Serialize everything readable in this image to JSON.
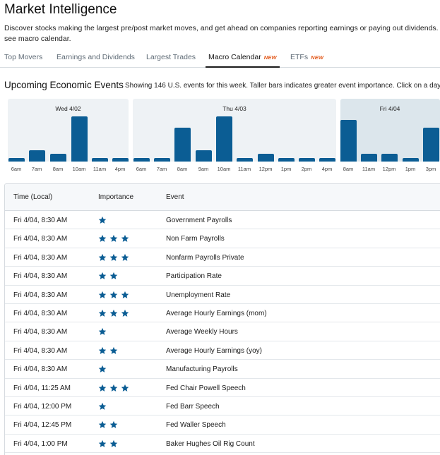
{
  "header": {
    "title": "Market Intelligence",
    "description": "Discover stocks making the largest pre/post market moves, and get ahead on companies reporting earnings or paying out dividends. Also see macro calendar."
  },
  "tabs": [
    {
      "label": "Top Movers",
      "badge": ""
    },
    {
      "label": "Earnings and Dividends",
      "badge": ""
    },
    {
      "label": "Largest Trades",
      "badge": ""
    },
    {
      "label": "Macro Calendar",
      "badge": "NEW"
    },
    {
      "label": "ETFs",
      "badge": "NEW"
    }
  ],
  "active_tab": "Macro Calendar",
  "section": {
    "title": "Upcoming Economic Events",
    "note": "Showing 146 U.S. events for this week. Taller bars indicates greater event importance. Click on a day to"
  },
  "colors": {
    "bar": "#0b5d94",
    "star": "#0b5d94",
    "new_badge": "#e35a1c",
    "selected_day": "#dce6ec"
  },
  "chart_data": {
    "type": "bar",
    "groups": [
      {
        "label": "Wed 4/02",
        "selected": false,
        "categories": [
          "6am",
          "7am",
          "8am",
          "10am",
          "11am",
          "4pm"
        ],
        "values": [
          1,
          3,
          2,
          12,
          1,
          1
        ]
      },
      {
        "label": "Thu 4/03",
        "selected": false,
        "categories": [
          "6am",
          "7am",
          "8am",
          "9am",
          "10am",
          "11am",
          "12pm",
          "1pm",
          "2pm",
          "4pm"
        ],
        "values": [
          1,
          1,
          9,
          3,
          12,
          1,
          2,
          1,
          1,
          1
        ]
      },
      {
        "label": "Fri 4/04",
        "selected": true,
        "categories": [
          "8am",
          "11am",
          "12pm",
          "1pm",
          "3pm"
        ],
        "values": [
          11,
          2,
          2,
          1,
          9
        ]
      }
    ]
  },
  "table": {
    "headers": {
      "time": "Time (Local)",
      "importance": "Importance",
      "event": "Event"
    },
    "rows": [
      {
        "time": "Fri 4/04, 8:30 AM",
        "importance": 1,
        "event": "Government Payrolls"
      },
      {
        "time": "Fri 4/04, 8:30 AM",
        "importance": 3,
        "event": "Non Farm Payrolls"
      },
      {
        "time": "Fri 4/04, 8:30 AM",
        "importance": 3,
        "event": "Nonfarm Payrolls Private"
      },
      {
        "time": "Fri 4/04, 8:30 AM",
        "importance": 2,
        "event": "Participation Rate"
      },
      {
        "time": "Fri 4/04, 8:30 AM",
        "importance": 3,
        "event": "Unemployment Rate"
      },
      {
        "time": "Fri 4/04, 8:30 AM",
        "importance": 3,
        "event": "Average Hourly Earnings (mom)"
      },
      {
        "time": "Fri 4/04, 8:30 AM",
        "importance": 1,
        "event": "Average Weekly Hours"
      },
      {
        "time": "Fri 4/04, 8:30 AM",
        "importance": 2,
        "event": "Average Hourly Earnings (yoy)"
      },
      {
        "time": "Fri 4/04, 8:30 AM",
        "importance": 1,
        "event": "Manufacturing Payrolls"
      },
      {
        "time": "Fri 4/04, 11:25 AM",
        "importance": 3,
        "event": "Fed Chair Powell Speech"
      },
      {
        "time": "Fri 4/04, 12:00 PM",
        "importance": 1,
        "event": "Fed Barr Speech"
      },
      {
        "time": "Fri 4/04, 12:45 PM",
        "importance": 2,
        "event": "Fed Waller Speech"
      },
      {
        "time": "Fri 4/04, 1:00 PM",
        "importance": 2,
        "event": "Baker Hughes Oil Rig Count"
      }
    ]
  }
}
